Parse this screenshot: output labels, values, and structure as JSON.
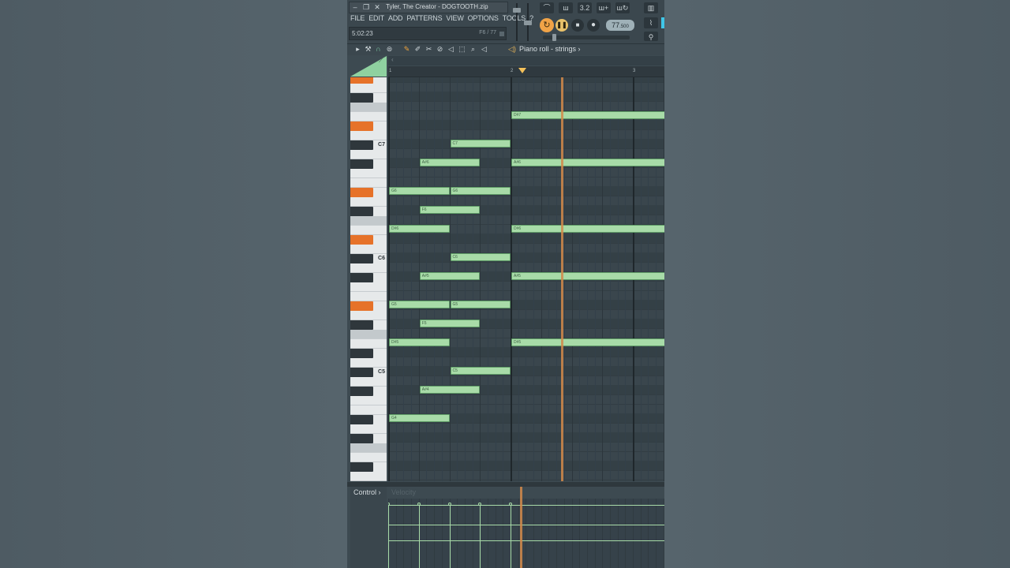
{
  "window": {
    "title": "Tyler, The Creator - DOGTOOTH.zip",
    "minimize_icon": "minimize-icon",
    "restore_icon": "restore-icon",
    "close_icon": "close-icon"
  },
  "menu": [
    "FILE",
    "EDIT",
    "ADD",
    "PATTERNS",
    "VIEW",
    "OPTIONS",
    "TOOLS",
    "?"
  ],
  "hint": {
    "time": "5:02:23",
    "right": "F6 / 77"
  },
  "transport": {
    "tempo_main": "77",
    "tempo_frac": ".500"
  },
  "toolbar": {
    "title": "Piano roll - strings",
    "title_arrow": "›",
    "tools": [
      "arrow-icon",
      "wrench-icon",
      "magnet-icon",
      "snap-icon",
      "pencil-icon",
      "brush-icon",
      "delete-icon",
      "mute-icon",
      "slice-icon",
      "select-icon",
      "zoom-icon",
      "playback-icon"
    ]
  },
  "ruler": [
    "1",
    "2",
    "3"
  ],
  "keys": {
    "c7": "C7",
    "c6": "C6",
    "c5": "C5"
  },
  "notes": [
    {
      "label": "D#7",
      "row": 4,
      "start": 4,
      "len": 10
    },
    {
      "label": "C7",
      "row": 7,
      "start": 2,
      "len": 2
    },
    {
      "label": "A#6",
      "row": 9,
      "start": 1,
      "len": 2
    },
    {
      "label": "A#6",
      "row": 9,
      "start": 4,
      "len": 10
    },
    {
      "label": "G6",
      "row": 12,
      "start": 0,
      "len": 2
    },
    {
      "label": "G6",
      "row": 12,
      "start": 2,
      "len": 2
    },
    {
      "label": "F6",
      "row": 14,
      "start": 1,
      "len": 2
    },
    {
      "label": "D#6",
      "row": 16,
      "start": 0,
      "len": 2
    },
    {
      "label": "D#6",
      "row": 16,
      "start": 4,
      "len": 10
    },
    {
      "label": "C6",
      "row": 19,
      "start": 2,
      "len": 2
    },
    {
      "label": "A#5",
      "row": 21,
      "start": 1,
      "len": 2
    },
    {
      "label": "A#5",
      "row": 21,
      "start": 4,
      "len": 10
    },
    {
      "label": "G5",
      "row": 24,
      "start": 0,
      "len": 2
    },
    {
      "label": "G5",
      "row": 24,
      "start": 2,
      "len": 2
    },
    {
      "label": "F5",
      "row": 26,
      "start": 1,
      "len": 2
    },
    {
      "label": "D#5",
      "row": 28,
      "start": 0,
      "len": 2
    },
    {
      "label": "D#5",
      "row": 28,
      "start": 4,
      "len": 10
    },
    {
      "label": "C5",
      "row": 31,
      "start": 2,
      "len": 2
    },
    {
      "label": "A#4",
      "row": 33,
      "start": 1,
      "len": 2
    },
    {
      "label": "G4",
      "row": 36,
      "start": 0,
      "len": 2
    }
  ],
  "highlighted_keys": [
    "D#7",
    "A#6",
    "D#6",
    "A#5",
    "D#5"
  ],
  "control": {
    "label": "Control",
    "arrow": "›",
    "param": "Velocity"
  },
  "colors": {
    "note": "#a8dba8",
    "key_highlight": "#e67229",
    "playhead": "#d38a4a",
    "accent_loop": "#f0a347"
  }
}
